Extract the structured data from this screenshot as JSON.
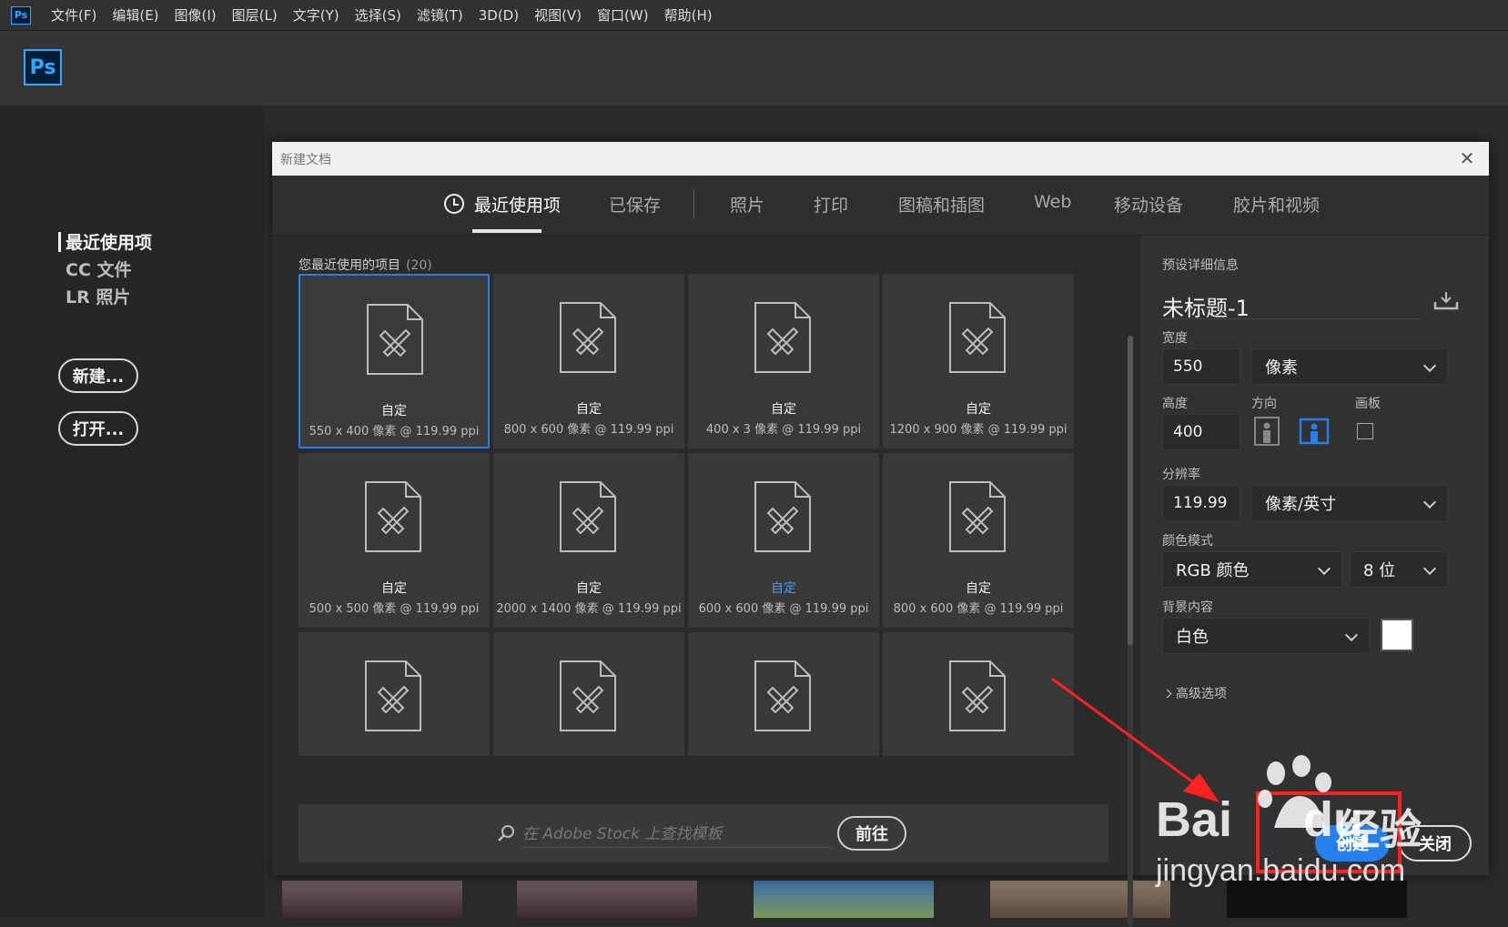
{
  "menubar": {
    "items": [
      "文件(F)",
      "编辑(E)",
      "图像(I)",
      "图层(L)",
      "文字(Y)",
      "选择(S)",
      "滤镜(T)",
      "3D(D)",
      "视图(V)",
      "窗口(W)",
      "帮助(H)"
    ],
    "app_icon": "Ps"
  },
  "home": {
    "logo": "Ps",
    "nav": [
      "最近使用项",
      "CC 文件",
      "LR 照片"
    ],
    "new_label": "新建...",
    "open_label": "打开..."
  },
  "dialog": {
    "title": "新建文档",
    "close_glyph": "✕",
    "tabs": [
      "最近使用项",
      "已保存",
      "照片",
      "打印",
      "图稿和插图",
      "Web",
      "移动设备",
      "胶片和视频"
    ],
    "recent_heading": "您最近使用的项目",
    "recent_count": "(20)",
    "cards": [
      {
        "name": "自定",
        "size": "550 x 400 像素 @ 119.99 ppi"
      },
      {
        "name": "自定",
        "size": "800 x 600 像素 @ 119.99 ppi"
      },
      {
        "name": "自定",
        "size": "400 x 3 像素 @ 119.99 ppi"
      },
      {
        "name": "自定",
        "size": "1200 x 900 像素 @ 119.99 ppi"
      },
      {
        "name": "自定",
        "size": "500 x 500 像素 @ 119.99 ppi"
      },
      {
        "name": "自定",
        "size": "2000 x 1400 像素 @ 119.99 ppi"
      },
      {
        "name": "自定",
        "size": "600 x 600 像素 @ 119.99 ppi"
      },
      {
        "name": "自定",
        "size": "800 x 600 像素 @ 119.99 ppi"
      }
    ],
    "search": {
      "placeholder": "在 Adobe Stock 上查找模板",
      "go_label": "前往"
    },
    "details": {
      "heading": "预设详细信息",
      "doc_name": "未标题-1",
      "width_label": "宽度",
      "width_value": "550",
      "width_unit": "像素",
      "height_label": "高度",
      "height_value": "400",
      "orientation_label": "方向",
      "artboard_label": "画板",
      "resolution_label": "分辨率",
      "resolution_value": "119.99",
      "resolution_unit": "像素/英寸",
      "color_mode_label": "颜色模式",
      "color_mode": "RGB 颜色",
      "bit_depth": "8 位",
      "background_label": "背景内容",
      "background": "白色",
      "advanced_label": "高级选项",
      "create_label": "创建",
      "close_label": "关闭"
    }
  },
  "watermark": {
    "brand": "Bai",
    "brand2": "du",
    "cn": "经验",
    "url": "jingyan.baidu.com"
  },
  "colors": {
    "accent": "#2680eb",
    "ps_blue": "#31a8ff",
    "highlight": "#ff2020"
  }
}
